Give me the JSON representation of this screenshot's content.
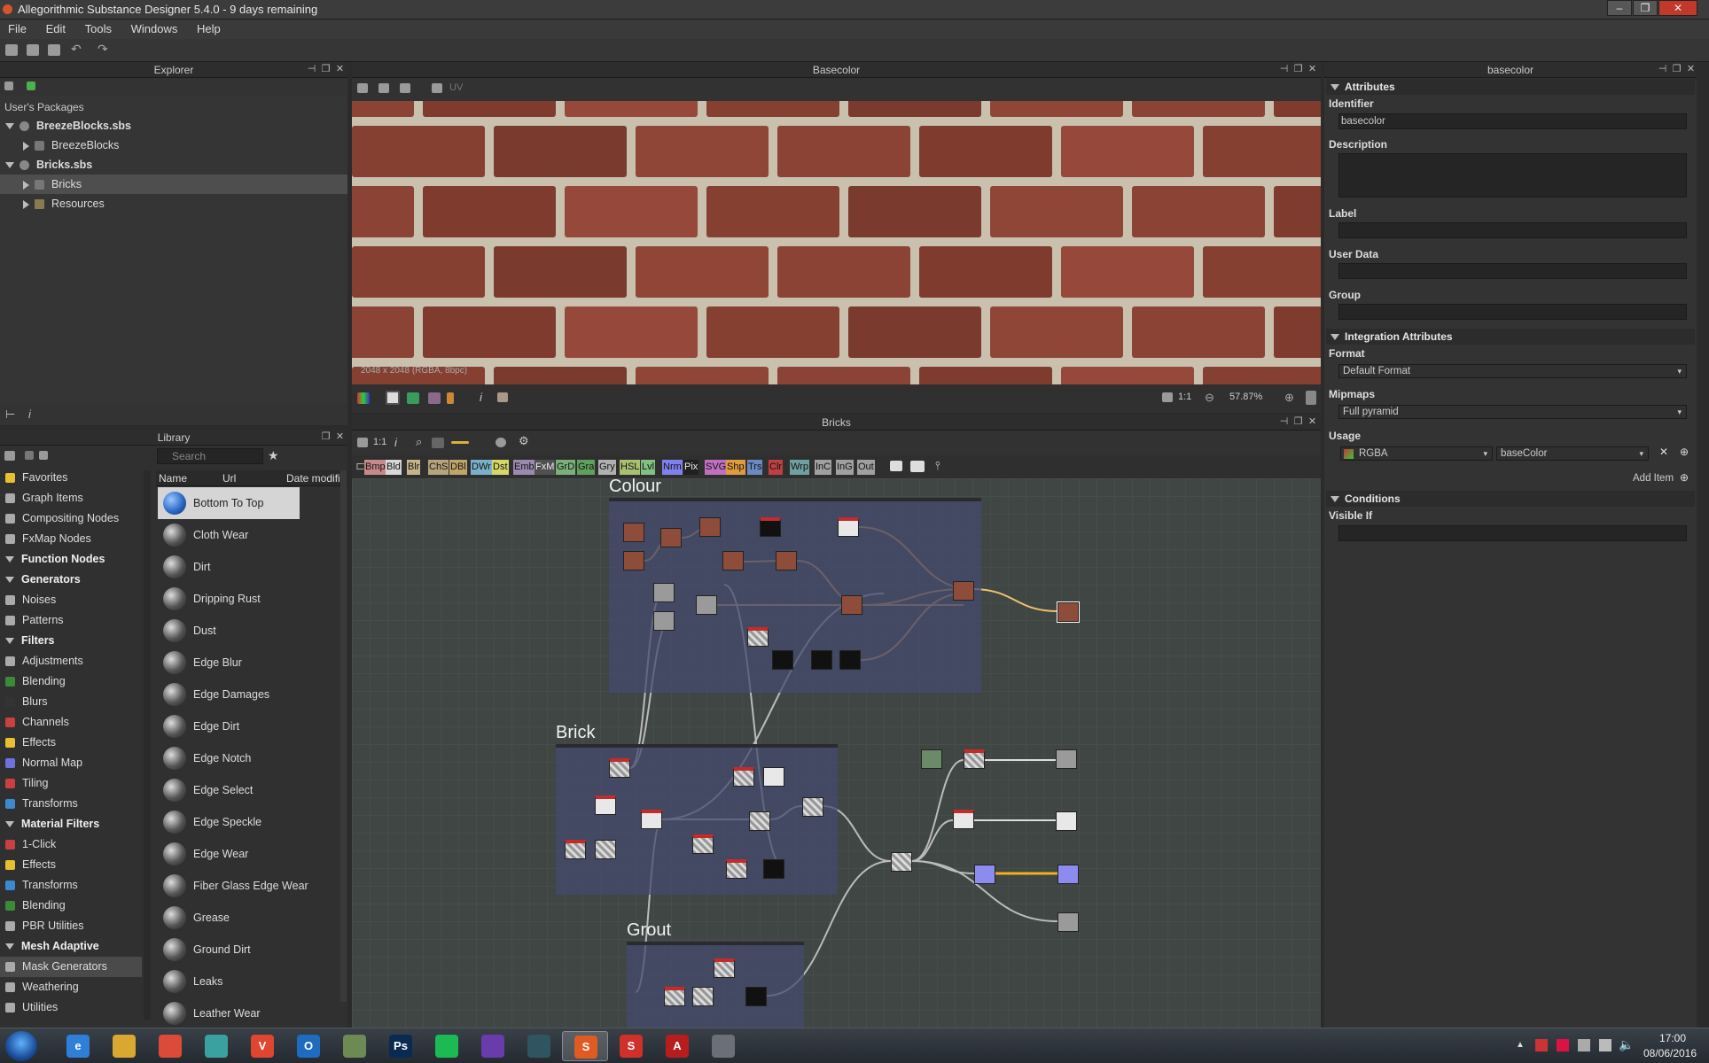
{
  "app": {
    "title": "Allegorithmic Substance Designer 5.4.0 - 9 days remaining"
  },
  "menu": [
    "File",
    "Edit",
    "Tools",
    "Windows",
    "Help"
  ],
  "explorer": {
    "title": "Explorer",
    "section": "User's Packages",
    "items": [
      {
        "label": "BreezeBlocks.sbs",
        "bold": true,
        "expanded": true
      },
      {
        "label": "BreezeBlocks",
        "bold": false,
        "expanded": false
      },
      {
        "label": "Bricks.sbs",
        "bold": true,
        "expanded": true
      },
      {
        "label": "Bricks",
        "bold": false,
        "expanded": false,
        "selected": true
      },
      {
        "label": "Resources",
        "bold": false,
        "expanded": false
      }
    ]
  },
  "viewer2d": {
    "title": "Basecolor",
    "info": "2048 x 2048 (RGBA, 8bpc)",
    "ratio": "1:1",
    "zoom": "57.87%",
    "mode": "UV"
  },
  "library": {
    "title": "Library",
    "search_placeholder": "Search",
    "columns": [
      "Name",
      "Url",
      "Date modifie"
    ],
    "categories": [
      {
        "label": "Favorites",
        "header": false,
        "color": "#e6c030"
      },
      {
        "label": "Graph Items",
        "header": false,
        "color": "#aaaaaa"
      },
      {
        "label": "Compositing Nodes",
        "header": false,
        "color": "#aaaaaa"
      },
      {
        "label": "FxMap Nodes",
        "header": false,
        "color": "#aaaaaa"
      },
      {
        "label": "Function Nodes",
        "header": true,
        "color": ""
      },
      {
        "label": "Generators",
        "header": true,
        "color": ""
      },
      {
        "label": "Noises",
        "header": false,
        "color": "#aaaaaa"
      },
      {
        "label": "Patterns",
        "header": false,
        "color": "#aaaaaa"
      },
      {
        "label": "Filters",
        "header": true,
        "color": ""
      },
      {
        "label": "Adjustments",
        "header": false,
        "color": "#aaaaaa"
      },
      {
        "label": "Blending",
        "header": false,
        "color": "#3a8a3a"
      },
      {
        "label": "Blurs",
        "header": false,
        "color": "#333333"
      },
      {
        "label": "Channels",
        "header": false,
        "color": "#c84040"
      },
      {
        "label": "Effects",
        "header": false,
        "color": "#e6c030"
      },
      {
        "label": "Normal Map",
        "header": false,
        "color": "#7070e0"
      },
      {
        "label": "Tiling",
        "header": false,
        "color": "#c84040"
      },
      {
        "label": "Transforms",
        "header": false,
        "color": "#3a8ad0"
      },
      {
        "label": "Material Filters",
        "header": true,
        "color": ""
      },
      {
        "label": "1-Click",
        "header": false,
        "color": "#c84040"
      },
      {
        "label": "Effects",
        "header": false,
        "color": "#e6c030"
      },
      {
        "label": "Transforms",
        "header": false,
        "color": "#3a8ad0"
      },
      {
        "label": "Blending",
        "header": false,
        "color": "#3a8a3a"
      },
      {
        "label": "PBR Utilities",
        "header": false,
        "color": "#aaaaaa"
      },
      {
        "label": "Mesh Adaptive",
        "header": true,
        "color": ""
      },
      {
        "label": "Mask Generators",
        "header": false,
        "color": "#aaaaaa",
        "selected": true
      },
      {
        "label": "Weathering",
        "header": false,
        "color": "#aaaaaa"
      },
      {
        "label": "Utilities",
        "header": false,
        "color": "#aaaaaa"
      }
    ],
    "items": [
      "Bottom To Top",
      "Cloth Wear",
      "Dirt",
      "Dripping Rust",
      "Dust",
      "Edge Blur",
      "Edge Damages",
      "Edge Dirt",
      "Edge Notch",
      "Edge Select",
      "Edge Speckle",
      "Edge Wear",
      "Fiber Glass Edge Wear",
      "Grease",
      "Ground Dirt",
      "Leaks",
      "Leather Wear"
    ]
  },
  "graph": {
    "title": "Bricks",
    "ratio": "1:1",
    "node_buttons": [
      {
        "label": "Bmp",
        "color": "#c78a8a"
      },
      {
        "label": "Bld",
        "color": "#d8d8d8"
      },
      {
        "label": "Blr",
        "color": "#c8b48a"
      },
      {
        "label": "ChS",
        "color": "#b7a47c"
      },
      {
        "label": "DBl",
        "color": "#bfa56a"
      },
      {
        "label": "DWr",
        "color": "#7ab0c8"
      },
      {
        "label": "Dst",
        "color": "#d6d66a"
      },
      {
        "label": "Emb",
        "color": "#9a8ab0"
      },
      {
        "label": "FxM",
        "color": "#505050"
      },
      {
        "label": "GrD",
        "color": "#7ab07a"
      },
      {
        "label": "Gra",
        "color": "#5fa05f"
      },
      {
        "label": "Gry",
        "color": "#b0b0b0"
      },
      {
        "label": "HSL",
        "color": "#a8c070"
      },
      {
        "label": "Lvl",
        "color": "#80c080"
      },
      {
        "label": "Nrm",
        "color": "#8080f0"
      },
      {
        "label": "Pix",
        "color": "#202020"
      },
      {
        "label": "SVG",
        "color": "#c070c0"
      },
      {
        "label": "Shp",
        "color": "#e09a40"
      },
      {
        "label": "Trs",
        "color": "#6a8ac0"
      },
      {
        "label": "Clr",
        "color": "#c04040"
      },
      {
        "label": "Wrp",
        "color": "#70a0a0"
      },
      {
        "label": "InC",
        "color": "#a0a0a0"
      },
      {
        "label": "InG",
        "color": "#a0a0a0"
      },
      {
        "label": "Out",
        "color": "#a0a0a0"
      }
    ],
    "frames": [
      "Colour",
      "Brick",
      "Grout"
    ]
  },
  "attributes": {
    "panel_title": "basecolor",
    "section": "Attributes",
    "identifier_label": "Identifier",
    "identifier": "basecolor",
    "description_label": "Description",
    "label_label": "Label",
    "userdata_label": "User Data",
    "group_label": "Group",
    "integration_section": "Integration Attributes",
    "format_label": "Format",
    "format": "Default Format",
    "mipmaps_label": "Mipmaps",
    "mipmaps": "Full pyramid",
    "usage_label": "Usage",
    "usage_channel": "RGBA",
    "usage_value": "baseColor",
    "add_item": "Add Item",
    "conditions_section": "Conditions",
    "visible_if_label": "Visible If"
  },
  "taskbar": {
    "apps": [
      {
        "name": "internet-explorer-icon",
        "color": "#2f7ed8",
        "glyph": "e"
      },
      {
        "name": "file-explorer-icon",
        "color": "#d9a830",
        "glyph": ""
      },
      {
        "name": "chrome-icon",
        "color": "#dc4a38",
        "glyph": ""
      },
      {
        "name": "map-app-icon",
        "color": "#3aa0a0",
        "glyph": ""
      },
      {
        "name": "vivaldi-icon",
        "color": "#e0452f",
        "glyph": "V"
      },
      {
        "name": "outlook-icon",
        "color": "#1f6bc0",
        "glyph": "O"
      },
      {
        "name": "image-viewer-icon",
        "color": "#6d8a55",
        "glyph": ""
      },
      {
        "name": "photoshop-icon",
        "color": "#0a2a52",
        "glyph": "Ps"
      },
      {
        "name": "spotify-icon",
        "color": "#1db954",
        "glyph": ""
      },
      {
        "name": "visual-studio-icon",
        "color": "#6a3cab",
        "glyph": ""
      },
      {
        "name": "3d-app-icon",
        "color": "#2f5560",
        "glyph": ""
      },
      {
        "name": "substance-designer-icon",
        "color": "#e05a24",
        "glyph": "S"
      },
      {
        "name": "substance-painter-icon",
        "color": "#d0302a",
        "glyph": "S"
      },
      {
        "name": "acrobat-icon",
        "color": "#b81d1d",
        "glyph": "A"
      },
      {
        "name": "other-app-icon",
        "color": "#6b7078",
        "glyph": ""
      }
    ],
    "time": "17:00",
    "date": "08/06/2016"
  }
}
